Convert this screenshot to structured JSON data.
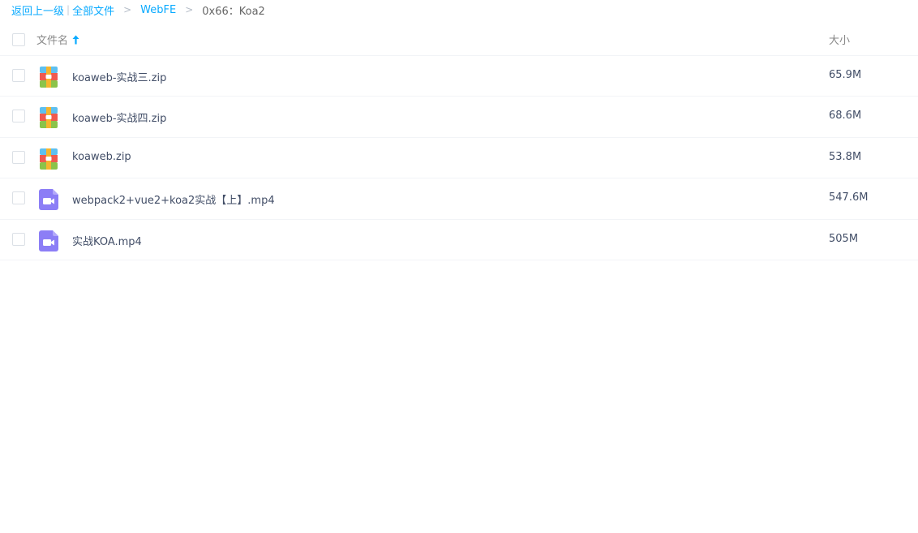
{
  "breadcrumb": {
    "back": "返回上一级",
    "pipe": "|",
    "all_files": "全部文件",
    "sep": ">",
    "folder": "WebFE",
    "current": "0x66：Koa2"
  },
  "header": {
    "name_label": "文件名",
    "size_label": "大小"
  },
  "files": [
    {
      "name": "koaweb-实战三.zip",
      "size": "65.9M",
      "type": "zip"
    },
    {
      "name": "koaweb-实战四.zip",
      "size": "68.6M",
      "type": "zip"
    },
    {
      "name": "koaweb.zip",
      "size": "53.8M",
      "type": "zip"
    },
    {
      "name": "webpack2+vue2+koa2实战【上】.mp4",
      "size": "547.6M",
      "type": "video"
    },
    {
      "name": "实战KOA.mp4",
      "size": "505M",
      "type": "video"
    }
  ],
  "colors": {
    "link": "#09aaff",
    "video_icon": "#8c7ef6",
    "text": "#424e67"
  }
}
